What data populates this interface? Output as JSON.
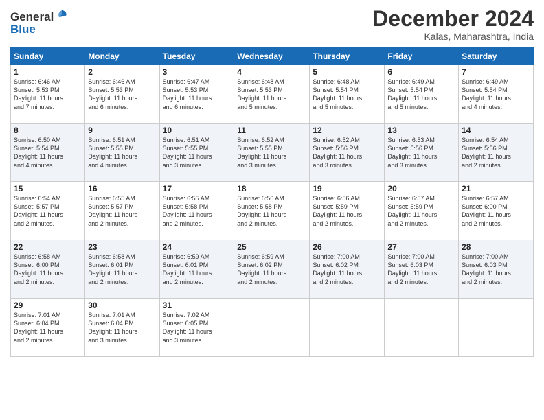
{
  "header": {
    "logo_line1": "General",
    "logo_line2": "Blue",
    "month": "December 2024",
    "location": "Kalas, Maharashtra, India"
  },
  "weekdays": [
    "Sunday",
    "Monday",
    "Tuesday",
    "Wednesday",
    "Thursday",
    "Friday",
    "Saturday"
  ],
  "weeks": [
    [
      {
        "day": "1",
        "sunrise": "6:46 AM",
        "sunset": "5:53 PM",
        "daylight": "11 hours and 7 minutes."
      },
      {
        "day": "2",
        "sunrise": "6:46 AM",
        "sunset": "5:53 PM",
        "daylight": "11 hours and 6 minutes."
      },
      {
        "day": "3",
        "sunrise": "6:47 AM",
        "sunset": "5:53 PM",
        "daylight": "11 hours and 6 minutes."
      },
      {
        "day": "4",
        "sunrise": "6:48 AM",
        "sunset": "5:53 PM",
        "daylight": "11 hours and 5 minutes."
      },
      {
        "day": "5",
        "sunrise": "6:48 AM",
        "sunset": "5:54 PM",
        "daylight": "11 hours and 5 minutes."
      },
      {
        "day": "6",
        "sunrise": "6:49 AM",
        "sunset": "5:54 PM",
        "daylight": "11 hours and 5 minutes."
      },
      {
        "day": "7",
        "sunrise": "6:49 AM",
        "sunset": "5:54 PM",
        "daylight": "11 hours and 4 minutes."
      }
    ],
    [
      {
        "day": "8",
        "sunrise": "6:50 AM",
        "sunset": "5:54 PM",
        "daylight": "11 hours and 4 minutes."
      },
      {
        "day": "9",
        "sunrise": "6:51 AM",
        "sunset": "5:55 PM",
        "daylight": "11 hours and 4 minutes."
      },
      {
        "day": "10",
        "sunrise": "6:51 AM",
        "sunset": "5:55 PM",
        "daylight": "11 hours and 3 minutes."
      },
      {
        "day": "11",
        "sunrise": "6:52 AM",
        "sunset": "5:55 PM",
        "daylight": "11 hours and 3 minutes."
      },
      {
        "day": "12",
        "sunrise": "6:52 AM",
        "sunset": "5:56 PM",
        "daylight": "11 hours and 3 minutes."
      },
      {
        "day": "13",
        "sunrise": "6:53 AM",
        "sunset": "5:56 PM",
        "daylight": "11 hours and 3 minutes."
      },
      {
        "day": "14",
        "sunrise": "6:54 AM",
        "sunset": "5:56 PM",
        "daylight": "11 hours and 2 minutes."
      }
    ],
    [
      {
        "day": "15",
        "sunrise": "6:54 AM",
        "sunset": "5:57 PM",
        "daylight": "11 hours and 2 minutes."
      },
      {
        "day": "16",
        "sunrise": "6:55 AM",
        "sunset": "5:57 PM",
        "daylight": "11 hours and 2 minutes."
      },
      {
        "day": "17",
        "sunrise": "6:55 AM",
        "sunset": "5:58 PM",
        "daylight": "11 hours and 2 minutes."
      },
      {
        "day": "18",
        "sunrise": "6:56 AM",
        "sunset": "5:58 PM",
        "daylight": "11 hours and 2 minutes."
      },
      {
        "day": "19",
        "sunrise": "6:56 AM",
        "sunset": "5:59 PM",
        "daylight": "11 hours and 2 minutes."
      },
      {
        "day": "20",
        "sunrise": "6:57 AM",
        "sunset": "5:59 PM",
        "daylight": "11 hours and 2 minutes."
      },
      {
        "day": "21",
        "sunrise": "6:57 AM",
        "sunset": "6:00 PM",
        "daylight": "11 hours and 2 minutes."
      }
    ],
    [
      {
        "day": "22",
        "sunrise": "6:58 AM",
        "sunset": "6:00 PM",
        "daylight": "11 hours and 2 minutes."
      },
      {
        "day": "23",
        "sunrise": "6:58 AM",
        "sunset": "6:01 PM",
        "daylight": "11 hours and 2 minutes."
      },
      {
        "day": "24",
        "sunrise": "6:59 AM",
        "sunset": "6:01 PM",
        "daylight": "11 hours and 2 minutes."
      },
      {
        "day": "25",
        "sunrise": "6:59 AM",
        "sunset": "6:02 PM",
        "daylight": "11 hours and 2 minutes."
      },
      {
        "day": "26",
        "sunrise": "7:00 AM",
        "sunset": "6:02 PM",
        "daylight": "11 hours and 2 minutes."
      },
      {
        "day": "27",
        "sunrise": "7:00 AM",
        "sunset": "6:03 PM",
        "daylight": "11 hours and 2 minutes."
      },
      {
        "day": "28",
        "sunrise": "7:00 AM",
        "sunset": "6:03 PM",
        "daylight": "11 hours and 2 minutes."
      }
    ],
    [
      {
        "day": "29",
        "sunrise": "7:01 AM",
        "sunset": "6:04 PM",
        "daylight": "11 hours and 2 minutes."
      },
      {
        "day": "30",
        "sunrise": "7:01 AM",
        "sunset": "6:04 PM",
        "daylight": "11 hours and 3 minutes."
      },
      {
        "day": "31",
        "sunrise": "7:02 AM",
        "sunset": "6:05 PM",
        "daylight": "11 hours and 3 minutes."
      },
      null,
      null,
      null,
      null
    ]
  ]
}
